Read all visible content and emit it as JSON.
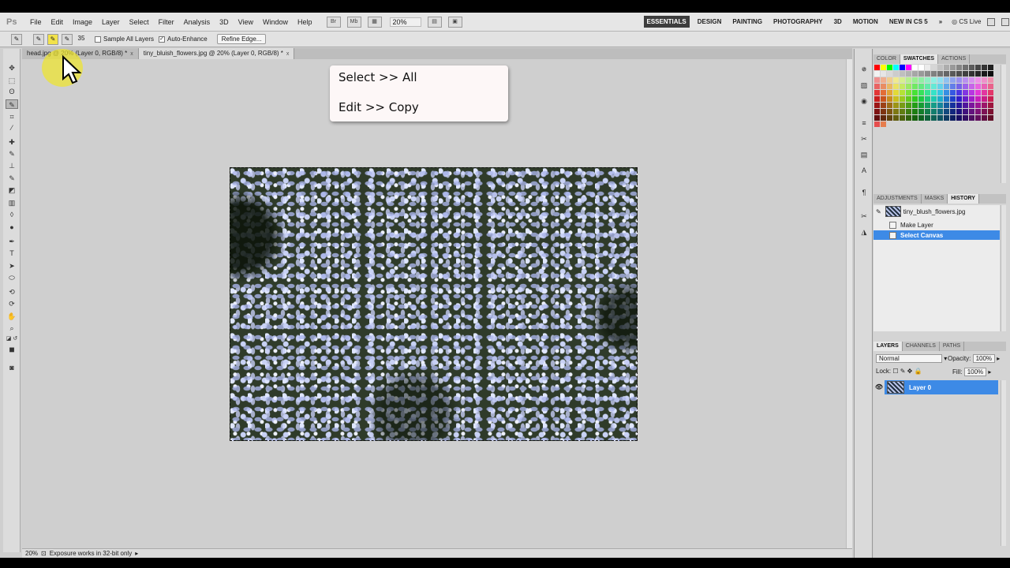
{
  "app": {
    "logo": "Ps"
  },
  "menu": [
    "File",
    "Edit",
    "Image",
    "Layer",
    "Select",
    "Filter",
    "Analysis",
    "3D",
    "View",
    "Window",
    "Help"
  ],
  "toolbar": {
    "zoom": "20%",
    "brush_size": "35"
  },
  "workspaces": [
    "ESSENTIALS",
    "DESIGN",
    "PAINTING",
    "PHOTOGRAPHY",
    "3D",
    "MOTION",
    "NEW IN CS 5",
    "»"
  ],
  "cs_live": "CS Live",
  "options": {
    "sample_all_layers": "Sample All Layers",
    "auto_enhance": "Auto-Enhance",
    "refine_edge": "Refine Edge..."
  },
  "tabs": [
    {
      "label": "head.jpg @ 20% (Layer 0, RGB/8) *",
      "close": "x"
    },
    {
      "label": "tiny_bluish_flowers.jpg @ 20% (Layer 0, RGB/8) *",
      "close": "x"
    }
  ],
  "callout": {
    "line1": "Select >> All",
    "line2": "Edit >> Copy"
  },
  "status": {
    "zoom": "20%",
    "message": "Exposure works in 32-bit only"
  },
  "panels": {
    "swatches_tabs": [
      "COLOR",
      "SWATCHES",
      "ACTIONS"
    ],
    "history_tabs": [
      "ADJUSTMENTS",
      "MASKS",
      "HISTORY"
    ],
    "history": {
      "snapshot": "tiny_blush_flowers.jpg",
      "items": [
        "Make Layer",
        "Select Canvas"
      ]
    },
    "layers_tabs": [
      "LAYERS",
      "CHANNELS",
      "PATHS"
    ],
    "layers": {
      "blend_mode": "Normal",
      "opacity_label": "Opacity:",
      "opacity": "100%",
      "lock_label": "Lock:",
      "fill_label": "Fill:",
      "fill": "100%",
      "layer_name": "Layer 0"
    }
  },
  "colors": {
    "selection_blue": "#3d8ae6",
    "cursor_highlight": "#f0e628"
  }
}
